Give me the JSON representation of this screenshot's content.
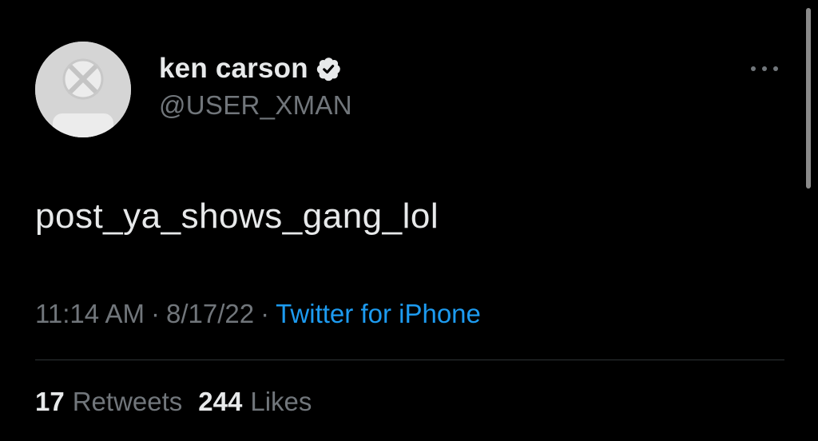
{
  "tweet": {
    "author": {
      "display_name": "ken carson",
      "handle": "@USER_XMAN",
      "verified": true,
      "avatar_icon": "default-avatar-icon"
    },
    "more_icon": "more-horizontal-icon",
    "text": "post_ya_shows_gang_lol",
    "time": "11:14 AM",
    "date": "8/17/22",
    "separator": "·",
    "source": "Twitter for iPhone",
    "stats": {
      "retweets_count": "17",
      "retweets_label": "Retweets",
      "likes_count": "244",
      "likes_label": "Likes"
    }
  },
  "colors": {
    "background": "#000000",
    "primary_text": "#e7e9ea",
    "secondary_text": "#71767b",
    "link": "#1d9bf0",
    "divider": "#2f3336"
  }
}
